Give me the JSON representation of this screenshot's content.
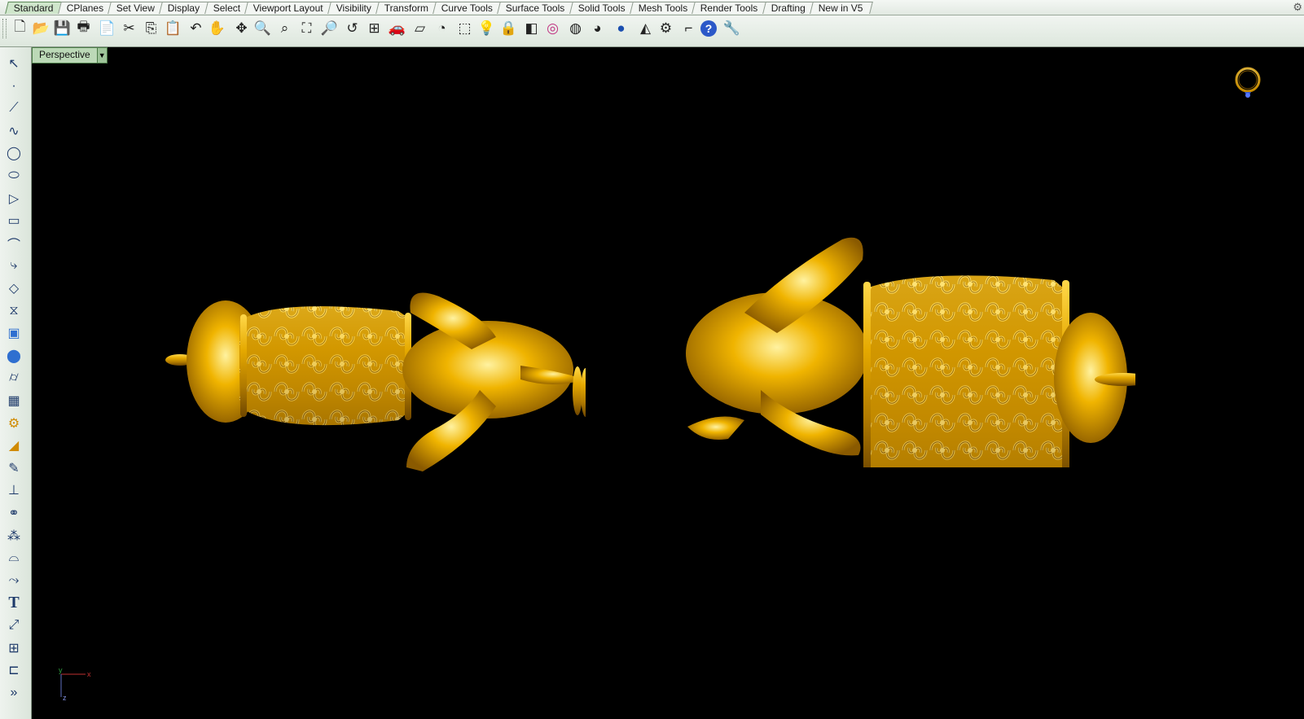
{
  "tabs": [
    {
      "label": "Standard",
      "active": true
    },
    {
      "label": "CPlanes"
    },
    {
      "label": "Set View"
    },
    {
      "label": "Display"
    },
    {
      "label": "Select"
    },
    {
      "label": "Viewport Layout"
    },
    {
      "label": "Visibility"
    },
    {
      "label": "Transform"
    },
    {
      "label": "Curve Tools"
    },
    {
      "label": "Surface Tools"
    },
    {
      "label": "Solid Tools"
    },
    {
      "label": "Mesh Tools"
    },
    {
      "label": "Render Tools"
    },
    {
      "label": "Drafting"
    },
    {
      "label": "New in V5"
    }
  ],
  "toolbar": {
    "icons": [
      "new-file-icon",
      "open-folder-icon",
      "save-icon",
      "print-icon",
      "import-icon",
      "cut-icon",
      "copy-icon",
      "paste-icon",
      "undo-icon",
      "pan-hand-icon",
      "rotate-view-icon",
      "zoom-dynamic-icon",
      "zoom-window-icon",
      "zoom-extents-icon",
      "zoom-selected-icon",
      "undo-view-icon",
      "four-viewports-icon",
      "car-options-icon",
      "cplane-icon",
      "layer-icon",
      "select-points-icon",
      "light-icon",
      "lock-icon",
      "properties-icon",
      "color-wheel-icon",
      "wireframe-sphere-icon",
      "shaded-sphere-icon",
      "rendered-sphere-icon",
      "filter-icon",
      "options-gear-icon",
      "dimension-icon",
      "help-icon",
      "tool-icon"
    ]
  },
  "left_toolbar": {
    "icons": [
      "select-arrow-icon",
      "point-icon",
      "polyline-icon",
      "curve-control-points-icon",
      "circle-icon",
      "ellipse-icon",
      "polygon-icon",
      "rectangle-icon",
      "arc-icon",
      "fillet-curve-icon",
      "surface-from-points-icon",
      "loft-icon",
      "box-solid-icon",
      "sphere-solid-icon",
      "cylinder-icon",
      "mesh-icon",
      "gear-transform-icon",
      "analyze-icon",
      "trim-icon",
      "split-icon",
      "boolean-icon",
      "group-icon",
      "offset-curve-icon",
      "extend-icon",
      "text-icon",
      "scale-icon",
      "array-icon",
      "dimension-left-icon",
      "more-icon"
    ]
  },
  "viewport": {
    "title": "Perspective",
    "axis": {
      "x": "x",
      "y": "y",
      "z": "z"
    }
  }
}
